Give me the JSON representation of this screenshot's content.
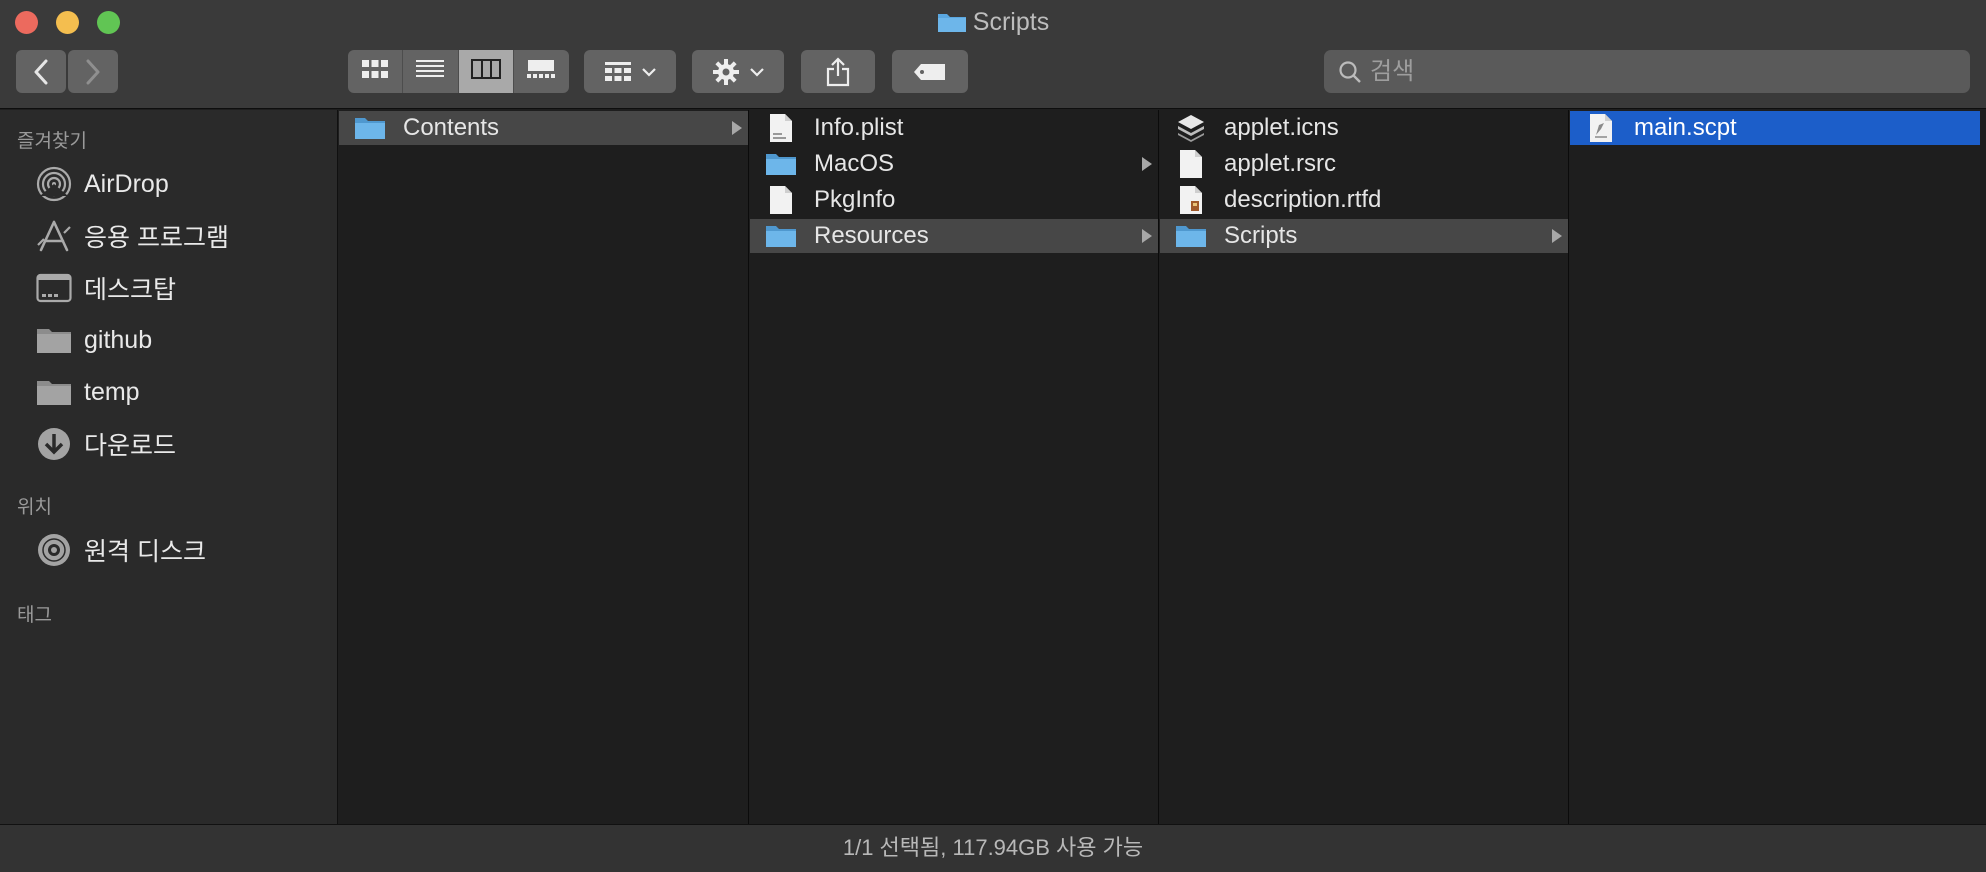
{
  "window": {
    "title": "Scripts"
  },
  "toolbar": {
    "back_icon": "chevron-left-icon",
    "forward_icon": "chevron-right-icon",
    "view_modes": [
      "icon-view",
      "list-view",
      "column-view",
      "gallery-view"
    ],
    "active_view": "column-view"
  },
  "search": {
    "placeholder": "검색"
  },
  "sidebar": {
    "favorites_header": "즐겨찾기",
    "favorites": [
      {
        "label": "AirDrop",
        "icon": "airdrop-icon"
      },
      {
        "label": "응용 프로그램",
        "icon": "applications-icon"
      },
      {
        "label": "데스크탑",
        "icon": "desktop-icon"
      },
      {
        "label": "github",
        "icon": "folder-icon"
      },
      {
        "label": "temp",
        "icon": "folder-icon"
      },
      {
        "label": "다운로드",
        "icon": "downloads-icon"
      }
    ],
    "locations_header": "위치",
    "locations": [
      {
        "label": "원격 디스크",
        "icon": "disc-icon"
      }
    ],
    "tags_header": "태그"
  },
  "columns": [
    [
      {
        "name": "Contents",
        "type": "folder",
        "state": "path",
        "has_children": true
      }
    ],
    [
      {
        "name": "Info.plist",
        "type": "plist",
        "state": "",
        "has_children": false
      },
      {
        "name": "MacOS",
        "type": "folder",
        "state": "",
        "has_children": true
      },
      {
        "name": "PkgInfo",
        "type": "file",
        "state": "",
        "has_children": false
      },
      {
        "name": "Resources",
        "type": "folder",
        "state": "path",
        "has_children": true
      }
    ],
    [
      {
        "name": "applet.icns",
        "type": "icns",
        "state": "",
        "has_children": false
      },
      {
        "name": "applet.rsrc",
        "type": "file",
        "state": "",
        "has_children": false
      },
      {
        "name": "description.rtfd",
        "type": "rtfd",
        "state": "",
        "has_children": false
      },
      {
        "name": "Scripts",
        "type": "folder",
        "state": "path",
        "has_children": true
      }
    ],
    [
      {
        "name": "main.scpt",
        "type": "script",
        "state": "selected",
        "has_children": false
      }
    ]
  ],
  "status": {
    "text": "1/1 선택됨, 117.94GB 사용 가능"
  },
  "colors": {
    "selection": "#1c5ec9",
    "path_highlight": "#474747",
    "folder": "#5aa7e0"
  }
}
